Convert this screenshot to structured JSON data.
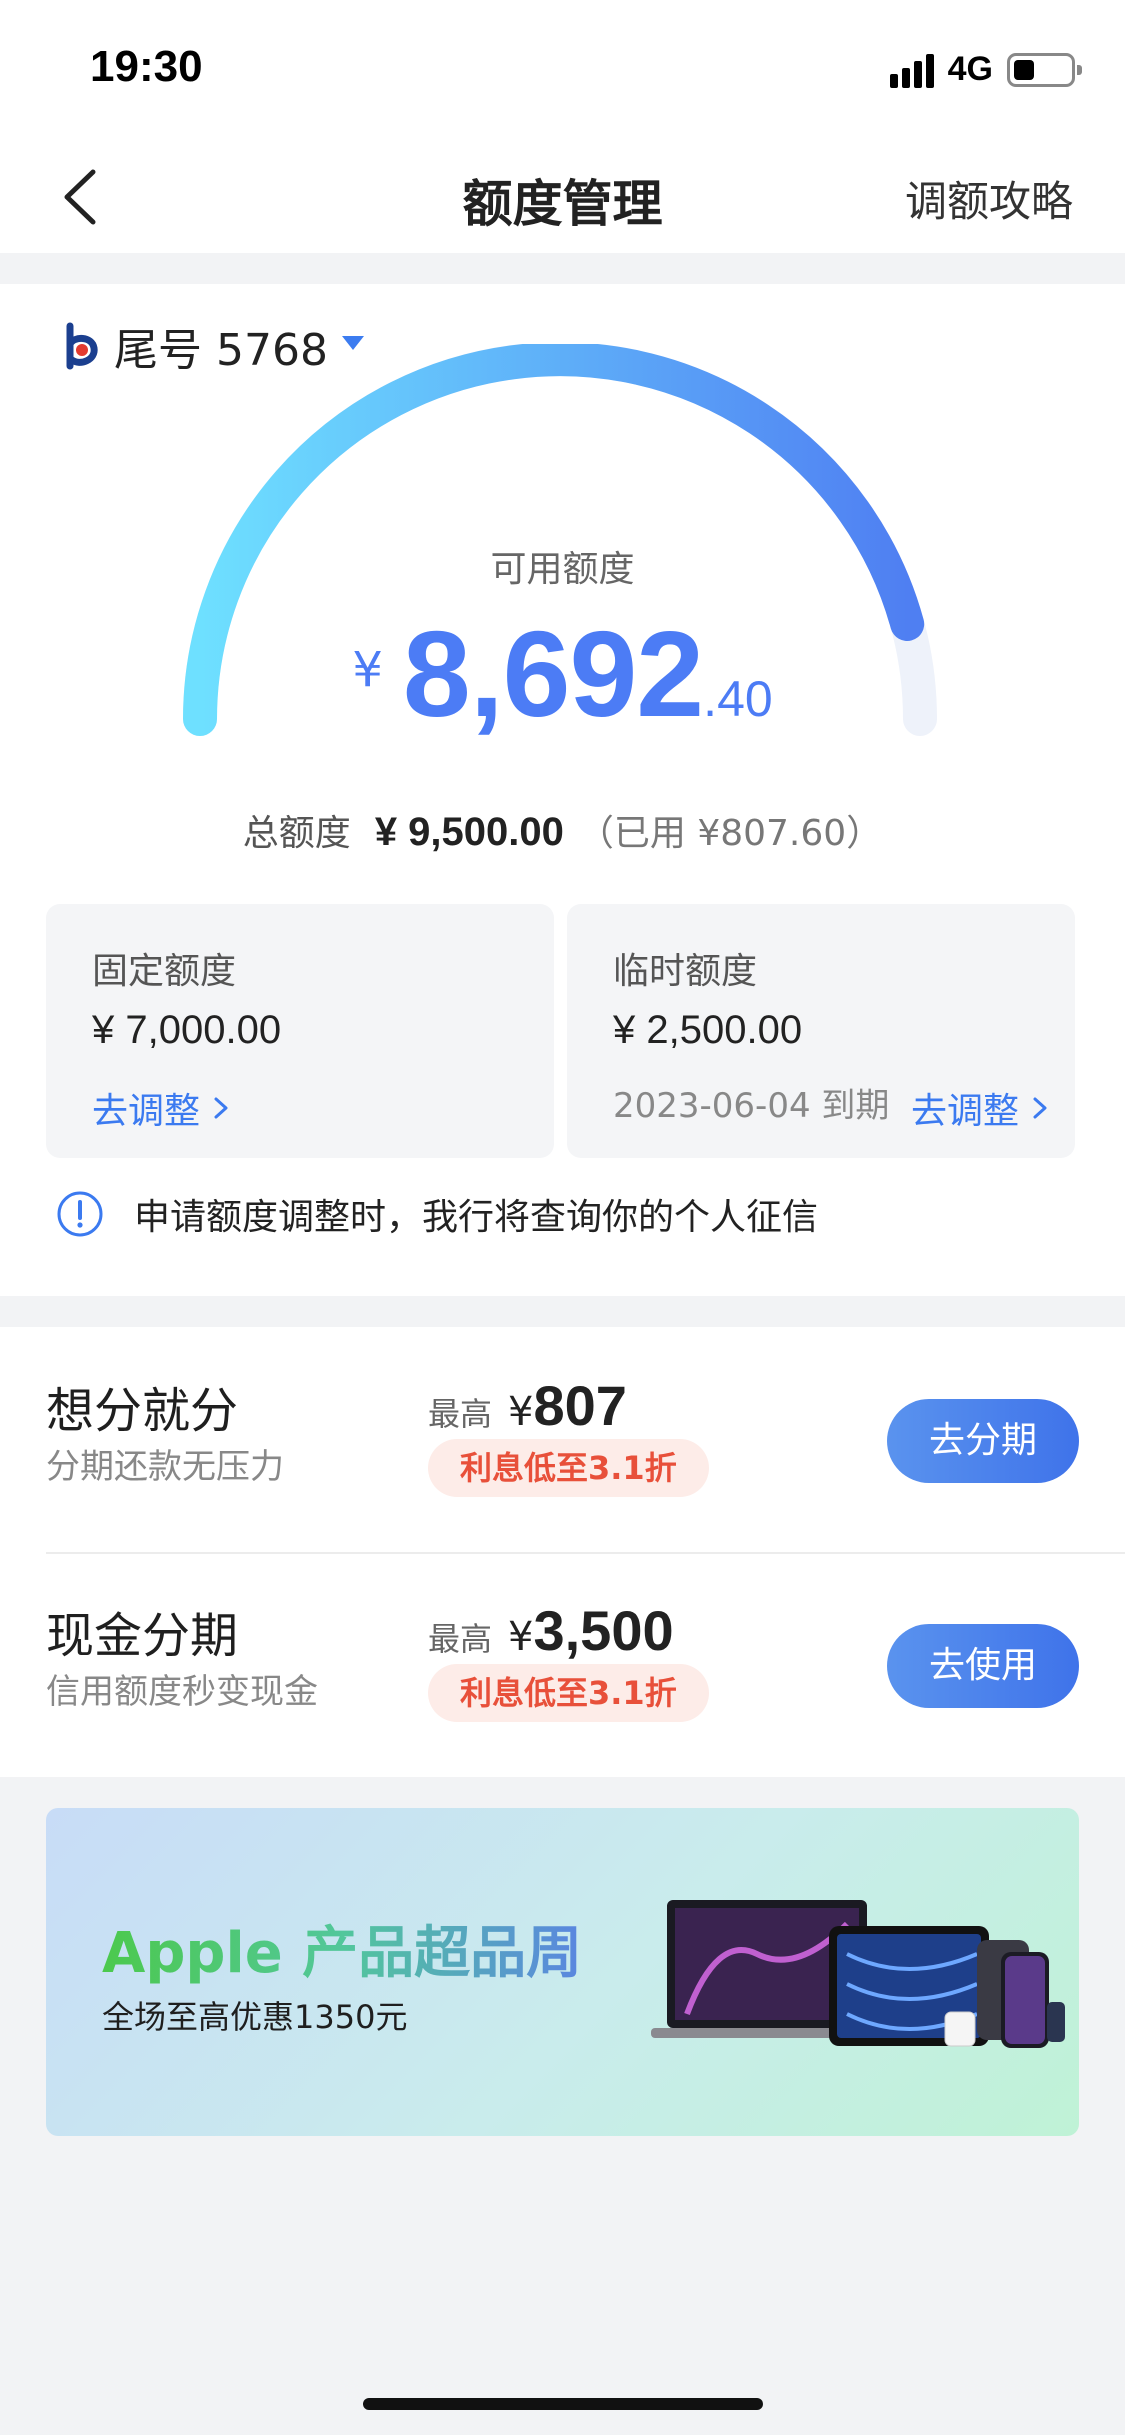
{
  "status_bar": {
    "time": "19:30",
    "network": "4G",
    "battery_level": 0.35
  },
  "nav": {
    "title": "额度管理",
    "right_link": "调额攻略"
  },
  "card": {
    "tail_label": "尾号 5768",
    "available_label": "可用额度",
    "available_currency": "¥",
    "available_integer": "8,692",
    "available_decimal": ".40",
    "usage_fraction": 0.915,
    "total_label": "总额度",
    "total_value": "¥ 9,500.00",
    "used_text": "（已用 ¥807.60）"
  },
  "quota": {
    "fixed": {
      "label": "固定额度",
      "value": "¥ 7,000.00",
      "adjust": "去调整"
    },
    "temp": {
      "label": "临时额度",
      "value": "¥ 2,500.00",
      "expire": "2023-06-04 到期",
      "adjust": "去调整"
    }
  },
  "notice": "申请额度调整时，我行将查询你的个人征信",
  "installments": [
    {
      "title": "想分就分",
      "subtitle": "分期还款无压力",
      "max_label": "最高",
      "max_currency": "¥",
      "max_value": "807",
      "rate_tag": "利息低至3.1折",
      "button": "去分期"
    },
    {
      "title": "现金分期",
      "subtitle": "信用额度秒变现金",
      "max_label": "最高",
      "max_currency": "¥",
      "max_value": "3,500",
      "rate_tag": "利息低至3.1折",
      "button": "去使用"
    }
  ],
  "banner": {
    "title": "Apple 产品超品周",
    "subtitle": "全场至高优惠1350元"
  },
  "colors": {
    "accent": "#4c7cf5",
    "gauge_start": "#6ee0ff",
    "gauge_end": "#4f7ff2",
    "rate_tag_text": "#e8503a",
    "rate_tag_bg": "#fdece8"
  },
  "icons": [
    "back-arrow-icon",
    "bank-logo-icon",
    "dropdown-triangle-icon",
    "chevron-right-icon",
    "info-icon",
    "signal-icon",
    "battery-icon"
  ]
}
